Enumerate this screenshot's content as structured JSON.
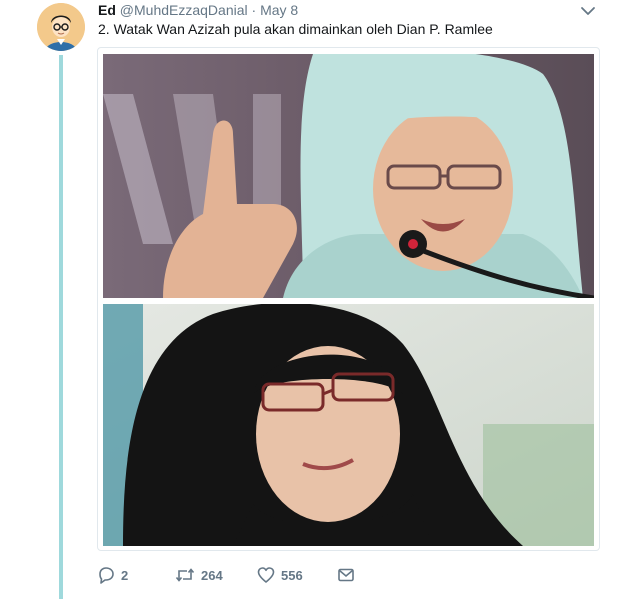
{
  "tweet": {
    "author_name": "Ed",
    "author_handle": "@MuhdEzzaqDanial",
    "separator": "·",
    "date": "May 8",
    "text": "2. Watak Wan Azizah pula akan dimainkan oleh Dian P. Ramlee",
    "media": [
      {
        "kind": "photo",
        "subject": "woman-in-light-hijab-speaking-at-microphone"
      },
      {
        "kind": "photo",
        "subject": "woman-in-black-hijab-with-glasses"
      }
    ]
  },
  "actions": {
    "reply_count": "2",
    "retweet_count": "264",
    "like_count": "556"
  },
  "icons": {
    "reply": "reply-icon",
    "retweet": "retweet-icon",
    "like": "heart-icon",
    "message": "envelope-icon",
    "menu": "chevron-down-icon"
  },
  "colors": {
    "thread_line": "#9fd9dc",
    "secondary_text": "#657786",
    "primary_text": "#14171a",
    "avatar_bg": "#f3c98b"
  }
}
